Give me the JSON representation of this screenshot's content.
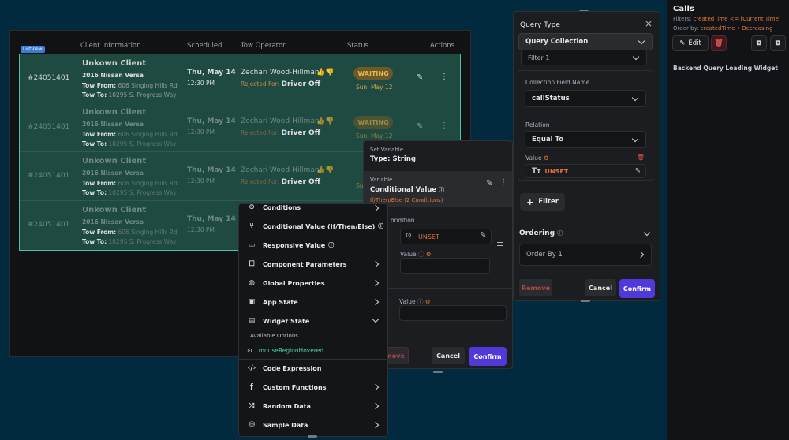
{
  "table": {
    "headers": [
      "Client Information",
      "Scheduled",
      "Tow Operator",
      "Status",
      "Actions"
    ],
    "listview_tag": "ListView",
    "rows": [
      {
        "id": "#24051401",
        "name": "Unkown Client",
        "car": "2016 Nissan Versa",
        "from_label": "Tow From:",
        "from_addr": "606 Singing Hills Rd",
        "to_label": "Tow To:",
        "to_addr": "10295 S. Progress Way",
        "date": "Thu, May 14",
        "time": "12:30 PM",
        "operator": "Zechari Wood-Hillman",
        "reject_label": "Rejected For:",
        "reject_reason": "Driver Off",
        "status": "WAITING",
        "status_date": "Sun, May 12"
      },
      {
        "id": "#24051401",
        "name": "Unkown Client",
        "car": "2016 Nissan Versa",
        "from_label": "Tow From:",
        "from_addr": "606 Singing Hills Rd",
        "to_label": "Tow To:",
        "to_addr": "10295 S. Progress Way",
        "date": "Thu, May 14",
        "time": "12:30 PM",
        "operator": "Zechari Wood-Hillman",
        "reject_label": "Rejected For:",
        "reject_reason": "Driver Off",
        "status": "WAITING",
        "status_date": "Sun, May 12"
      },
      {
        "id": "#24051401",
        "name": "Unkown Client",
        "car": "2016 Nissan Versa",
        "from_label": "Tow From:",
        "from_addr": "606 Singing Hills Rd",
        "to_label": "Tow To:",
        "to_addr": "10295 S. Progress Way",
        "date": "Thu, May 14",
        "time": "12:30 PM",
        "operator": "Zechari Wood-Hillman",
        "reject_label": "Rejected For:",
        "reject_reason": "Driver Off",
        "status": "",
        "status_date": "Su"
      },
      {
        "id": "#24051401",
        "name": "Unkown Client",
        "car": "2016 Nissan Versa",
        "from_label": "Tow From:",
        "from_addr": "606 Singing Hills Rd",
        "to_label": "Tow To:",
        "to_addr": "10295 S. Progress Way",
        "date": "Thu, May 14",
        "time": "12:30 PM",
        "operator": "",
        "reject_label": "",
        "reject_reason": "",
        "status": "",
        "status_date": ""
      }
    ]
  },
  "props": {
    "title": "Calls",
    "filters_label": "Filters:",
    "filters_value": "createdTime <= [Current Time]",
    "order_label": "Order by:",
    "order_value": "createdTime • Decreasing",
    "edit_label": "Edit",
    "backend_label": "Backend Query Loading Widget"
  },
  "query": {
    "title": "Query Type",
    "type_value": "Query Collection",
    "filter_value": "Filter 1",
    "field_label": "Collection Field Name",
    "field_value": "callStatus",
    "relation_label": "Relation",
    "relation_value": "Equal To",
    "value_label": "Value",
    "value_text": "UNSET",
    "filter_button": "Filter",
    "ordering_label": "Ordering",
    "order_by": "Order By 1",
    "remove": "Remove",
    "cancel": "Cancel",
    "confirm": "Confirm"
  },
  "variable": {
    "header_small": "Set Variable",
    "header_type": "Type: String",
    "var_label": "Variable",
    "var_value": "Conditional Value",
    "var_sub": "If/Then/Else (2 Conditions)",
    "condition_label": "ondition",
    "unset": "UNSET",
    "value_label1": "Value",
    "value_label2": "Value",
    "remove_frag": "nove",
    "cancel": "Cancel",
    "confirm": "Confirm"
  },
  "menu": {
    "items": [
      {
        "label": "Conditions",
        "icon": "conditions-icon"
      },
      {
        "label": "Conditional Value (If/Then/Else)",
        "icon": "branch-icon"
      },
      {
        "label": "Responsive Value",
        "icon": "responsive-icon"
      },
      {
        "label": "Component Parameters",
        "icon": "component-icon"
      },
      {
        "label": "Global Properties",
        "icon": "globe-icon"
      },
      {
        "label": "App State",
        "icon": "app-state-icon"
      },
      {
        "label": "Widget State",
        "icon": "widget-state-icon"
      }
    ],
    "available_label": "Available Options",
    "option": "mouseRegionHovered",
    "items_bottom": [
      {
        "label": "Code Expression",
        "icon": "code-icon"
      },
      {
        "label": "Custom Functions",
        "icon": "function-icon"
      },
      {
        "label": "Random Data",
        "icon": "shuffle-icon"
      },
      {
        "label": "Sample Data",
        "icon": "database-icon"
      }
    ]
  },
  "colors": {
    "accent": "#4f3ad9",
    "listview_border": "#4fc3a1",
    "waiting": "#e6b84a",
    "unset": "#e0703a",
    "remove": "#e0564a"
  }
}
